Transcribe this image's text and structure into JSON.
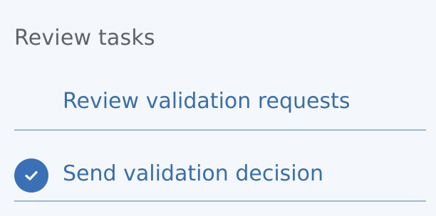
{
  "section": {
    "heading": "Review tasks"
  },
  "tasks": [
    {
      "label": "Review validation requests",
      "completed": false
    },
    {
      "label": "Send validation decision",
      "completed": true,
      "status_icon": "checkmark-icon"
    }
  ],
  "colors": {
    "background": "#f4f7fb",
    "heading": "#5f6368",
    "link": "#3a6ea8",
    "divider": "#9cb9d8",
    "check_badge": "#3a70b5"
  }
}
